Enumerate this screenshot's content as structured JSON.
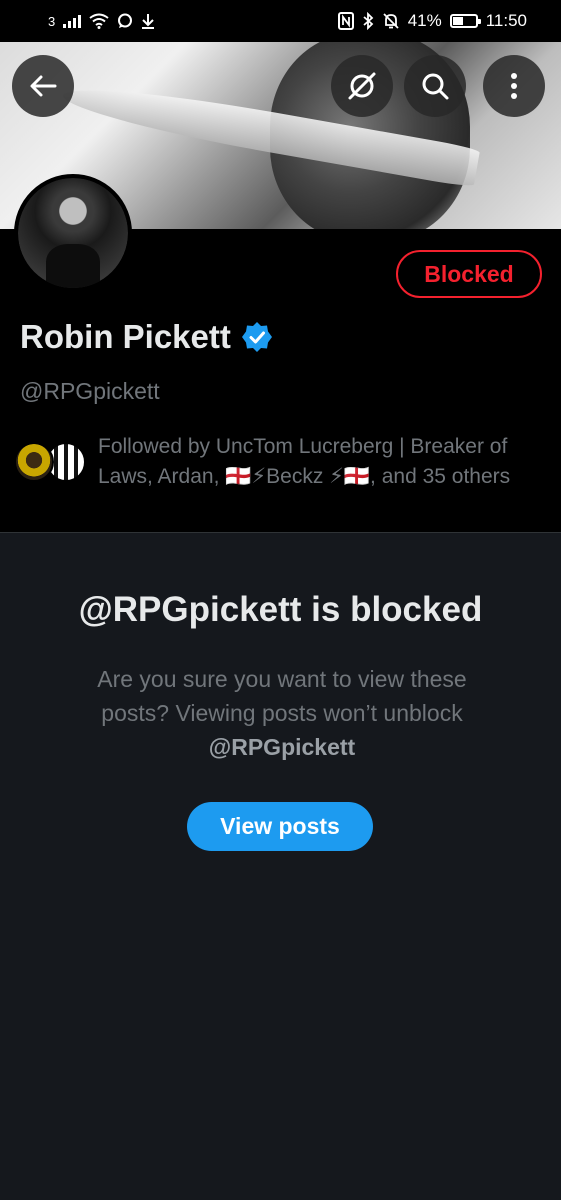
{
  "status_bar": {
    "sim": "3",
    "battery": "41%",
    "time": "11:50"
  },
  "header": {
    "back_icon": "arrow-left-icon",
    "grok_icon": "grok-icon",
    "search_icon": "search-icon",
    "more_icon": "more-vertical-icon"
  },
  "profile": {
    "name": "Robin Pickett",
    "handle": "@RPGpickett",
    "blocked_label": "Blocked",
    "followed_by": "Followed by UncTom Lucreberg | Breaker of Laws, Ardan, 🏴󠁧󠁢󠁥󠁮󠁧󠁿⚡Beckz ⚡🏴󠁧󠁢󠁥󠁮󠁧󠁿, and 35 others"
  },
  "blocked_notice": {
    "title": "@RPGpickett is blocked",
    "description_prefix": "Are you sure you want to view these posts? Viewing posts won’t unblock ",
    "description_handle": "@RPGpickett",
    "view_button": "View posts"
  },
  "colors": {
    "accent": "#1d9bf0",
    "blocked": "#f4212e",
    "background": "#15181d"
  }
}
